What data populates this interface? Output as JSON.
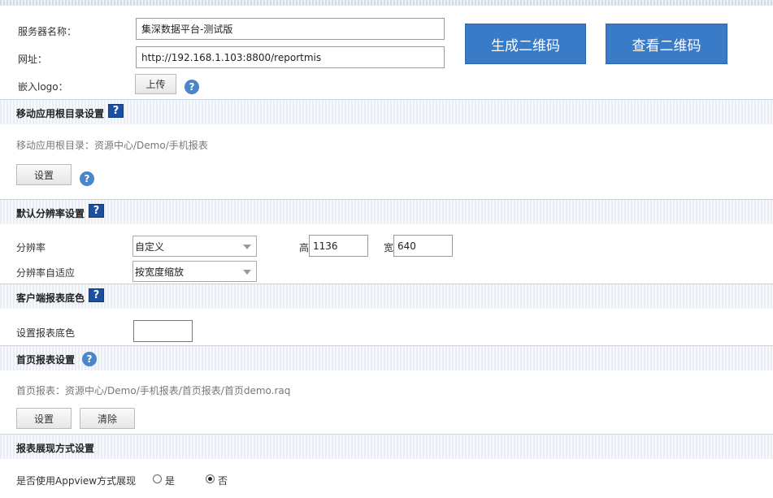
{
  "server": {
    "name_label": "服务器名称：",
    "name_value": "集深数据平台-测试版",
    "url_label": "网址：",
    "url_value": "http://192.168.1.103:8800/reportmis",
    "logo_label": "嵌入logo：",
    "upload_button": "上传",
    "generate_qr_button": "生成二维码",
    "view_qr_button": "查看二维码"
  },
  "mobile_root": {
    "title": "移动应用根目录设置",
    "path_text": "移动应用根目录：资源中心/Demo/手机报表",
    "set_button": "设置"
  },
  "resolution": {
    "title": "默认分辨率设置",
    "resolution_label": "分辨率",
    "resolution_value": "自定义",
    "height_label": "高",
    "height_value": "1136",
    "width_label": "宽",
    "width_value": "640",
    "adapt_label": "分辨率自适应",
    "adapt_value": "按宽度缩放"
  },
  "bgcolor": {
    "title": "客户端报表底色",
    "set_label": "设置报表底色",
    "color_value": "#ffffff"
  },
  "homepage": {
    "title": "首页报表设置",
    "path_text": "首页报表：资源中心/Demo/手机报表/首页报表/首页demo.raq",
    "set_button": "设置",
    "clear_button": "清除"
  },
  "display_mode": {
    "title": "报表展现方式设置",
    "appview_label": "是否使用Appview方式展现",
    "option_yes": "是",
    "option_no": "否",
    "selected": "否"
  },
  "colors": {
    "primary_button": "#3a7bc8",
    "help_square": "#1c4fa0",
    "help_circle": "#4a86c9"
  },
  "help_symbol": "?"
}
